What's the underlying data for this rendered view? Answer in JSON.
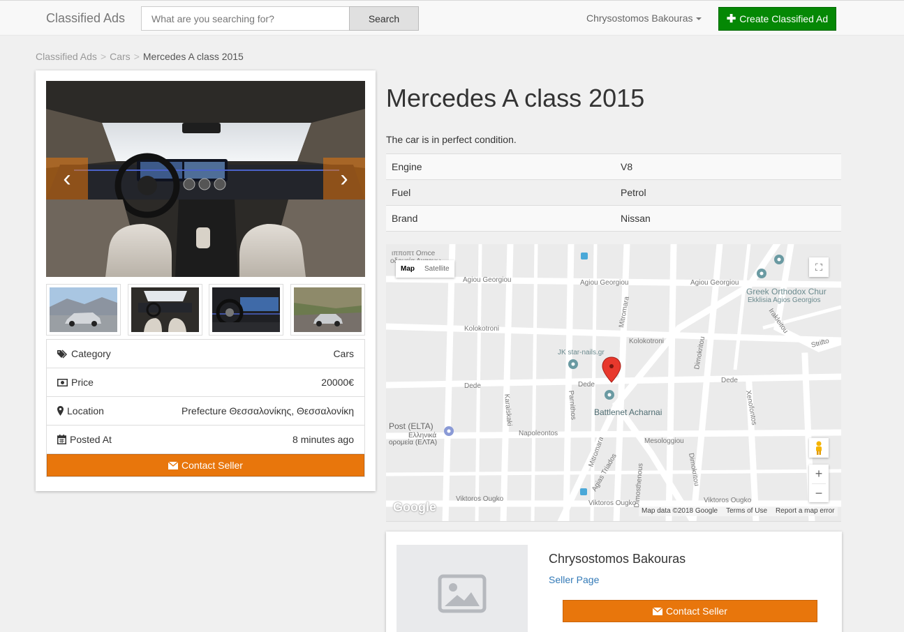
{
  "navbar": {
    "brand": "Classified Ads",
    "search_placeholder": "What are you searching for?",
    "search_button": "Search",
    "user_name": "Chrysostomos Bakouras",
    "create_button": "Create Classified Ad",
    "create_color": "#058805"
  },
  "breadcrumb": [
    "Classified Ads",
    "Cars",
    "Mercedes A class 2015"
  ],
  "ad": {
    "title": "Mercedes A class 2015",
    "description": "The car is in perfect condition.",
    "specs": [
      {
        "key": "Engine",
        "value": "V8"
      },
      {
        "key": "Fuel",
        "value": "Petrol"
      },
      {
        "key": "Brand",
        "value": "Nissan"
      }
    ],
    "info": [
      {
        "icon": "tags-icon",
        "label": "Category",
        "value": "Cars"
      },
      {
        "icon": "money-icon",
        "label": "Price",
        "value": "20000€"
      },
      {
        "icon": "map-marker-icon",
        "label": "Location",
        "value": "Prefecture Θεσσαλονίκης, Θεσσαλονίκη"
      },
      {
        "icon": "calendar-icon",
        "label": "Posted At",
        "value": "8 minutes ago"
      }
    ],
    "contact_button": "Contact Seller",
    "accent_color": "#e8760c"
  },
  "map": {
    "type_map": "Map",
    "type_satellite": "Satellite",
    "labels": {
      "church_1": "Greek Orthodox Chur",
      "church_2": "Ekklisia Agios Georgios",
      "jk": "JK star-nails.gr",
      "battlenet": "Battlenet Acharnai",
      "post_1": "Post (ELTA)",
      "post_2": "Ελληνικά",
      "post_3": "ορομεία (ΕΛΤΑ)",
      "top_cut_1": "ιπποπτ Ornce",
      "top_cut_2": "οδομεία Αχαρνω"
    },
    "streets": {
      "agiou_1": "Agiou Georgiou",
      "agiou_2": "Agiou Georgiou",
      "agiou_3": "Agiou Georgiou",
      "kolokotroni_1": "Kolokotroni",
      "kolokotroni_2": "Kolokotroni",
      "dede_1": "Dede",
      "dede_2": "Dede",
      "dede_3": "Dede",
      "napoleontos": "Napoleontos",
      "mesologgiou": "Mesologgiou",
      "viktoros_1": "Viktoros Ougko",
      "viktoros_2": "Viktoros Ougko",
      "viktoros_3": "Viktoros Ougko",
      "mitromara_1": "Mitromara",
      "mitromara_2": "Mitromara",
      "parnithos": "Parnithos",
      "karaiskaki": "Karaiskaki",
      "agias_triados": "Agias Triados",
      "dimosthenous": "Dimosthenous",
      "dimokritou_1": "Dimokritou",
      "dimokritou_2": "Dimokritou",
      "xenofontos": "Xenofontos",
      "irakleitou": "Irakleitou",
      "strifton": "Strifto"
    },
    "google_logo": "Google",
    "footer": [
      "Map data ©2018 Google",
      "Terms of Use",
      "Report a map error"
    ],
    "zoom_in": "+",
    "zoom_out": "−"
  },
  "seller": {
    "name": "Chrysostomos Bakouras",
    "link": "Seller Page",
    "contact_button": "Contact Seller"
  }
}
